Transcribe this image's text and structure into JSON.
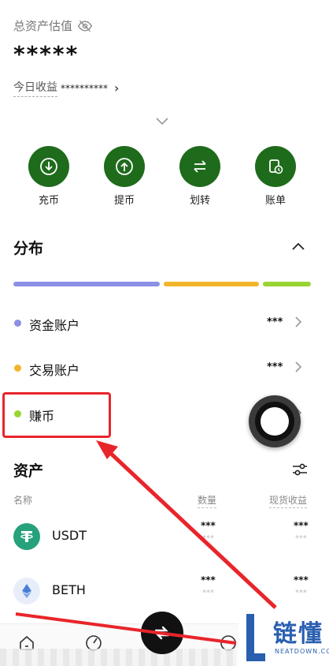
{
  "header": {
    "total_assets_label": "总资产估值",
    "total_assets_value": "*****",
    "today_earnings_label": "今日收益",
    "today_earnings_value": "**********",
    "today_chevron": "›"
  },
  "actions": [
    {
      "label": "充币",
      "icon": "deposit-icon"
    },
    {
      "label": "提币",
      "icon": "withdraw-icon"
    },
    {
      "label": "划转",
      "icon": "transfer-icon"
    },
    {
      "label": "账单",
      "icon": "bill-icon"
    }
  ],
  "distribution": {
    "title": "分布",
    "segments": [
      {
        "color": "#8b8fe6",
        "fraction": 0.5
      },
      {
        "color": "#f2b52a",
        "fraction": 0.32
      },
      {
        "color": "#9ad432",
        "fraction": 0.16
      }
    ],
    "accounts": [
      {
        "name": "资金账户",
        "value": "***",
        "dot_color": "#8b8fe6"
      },
      {
        "name": "交易账户",
        "value": "***",
        "dot_color": "#f2b52a"
      },
      {
        "name": "赚币",
        "value": "",
        "dot_color": "#9ad432"
      }
    ]
  },
  "assets": {
    "title": "资产",
    "col_name": "名称",
    "col_quantity": "数量",
    "col_earnings": "现货收益",
    "rows": [
      {
        "symbol": "USDT",
        "qty": "***",
        "qty_sub": "***",
        "earn": "***",
        "earn_sub": "***",
        "logo_color": "#26a17b"
      },
      {
        "symbol": "BETH",
        "qty": "***",
        "qty_sub": "***",
        "earn": "***",
        "earn_sub": "***",
        "logo_color": "#e8eef9"
      }
    ]
  },
  "watermark": {
    "cn": "链懂",
    "en": "NEATDOWN.COM"
  },
  "colors": {
    "accent_green": "#1f6b1c",
    "highlight_red": "#e8252b"
  }
}
